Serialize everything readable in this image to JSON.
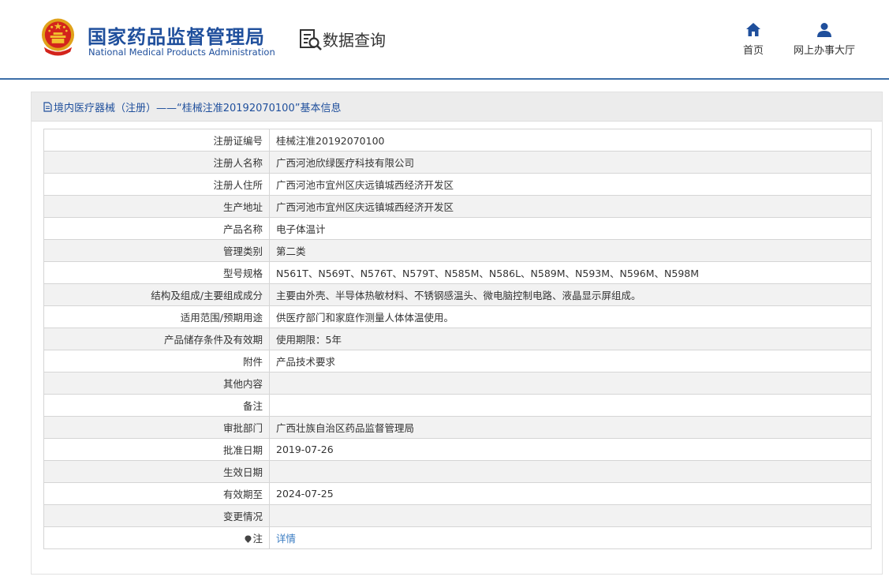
{
  "header": {
    "agency_cn": "国家药品监督管理局",
    "agency_en": "National Medical Products Administration",
    "query_title": "数据查询",
    "nav": [
      {
        "label": "首页",
        "icon": "home-icon"
      },
      {
        "label": "网上办事大厅",
        "icon": "user-icon"
      }
    ],
    "brand_color": "#1f4f9c",
    "accent_line_color": "#3b6ea8"
  },
  "panel": {
    "title": "境内医疗器械（注册）——“桂械注准20192070100”基本信息",
    "rows": [
      {
        "label": "注册证编号",
        "value": "桂械注准20192070100"
      },
      {
        "label": "注册人名称",
        "value": "广西河池欣绿医疗科技有限公司"
      },
      {
        "label": "注册人住所",
        "value": "广西河池市宜州区庆远镇城西经济开发区"
      },
      {
        "label": "生产地址",
        "value": "广西河池市宜州区庆远镇城西经济开发区"
      },
      {
        "label": "产品名称",
        "value": "电子体温计"
      },
      {
        "label": "管理类别",
        "value": "第二类"
      },
      {
        "label": "型号规格",
        "value": "N561T、N569T、N576T、N579T、N585M、N586L、N589M、N593M、N596M、N598M"
      },
      {
        "label": "结构及组成/主要组成成分",
        "value": "主要由外壳、半导体热敏材料、不锈钢感温头、微电脑控制电路、液晶显示屏组成。"
      },
      {
        "label": "适用范围/预期用途",
        "value": "供医疗部门和家庭作测量人体体温使用。"
      },
      {
        "label": "产品储存条件及有效期",
        "value": "使用期限：5年"
      },
      {
        "label": "附件",
        "value": "产品技术要求"
      },
      {
        "label": "其他内容",
        "value": ""
      },
      {
        "label": "备注",
        "value": ""
      },
      {
        "label": "审批部门",
        "value": "广西壮族自治区药品监督管理局"
      },
      {
        "label": "批准日期",
        "value": "2019-07-26"
      },
      {
        "label": "生效日期",
        "value": ""
      },
      {
        "label": "有效期至",
        "value": "2024-07-25"
      },
      {
        "label": "变更情况",
        "value": ""
      }
    ],
    "note": {
      "label": "注",
      "link_text": "详情",
      "icon": "note-icon"
    },
    "link_color": "#3a7cc2"
  }
}
